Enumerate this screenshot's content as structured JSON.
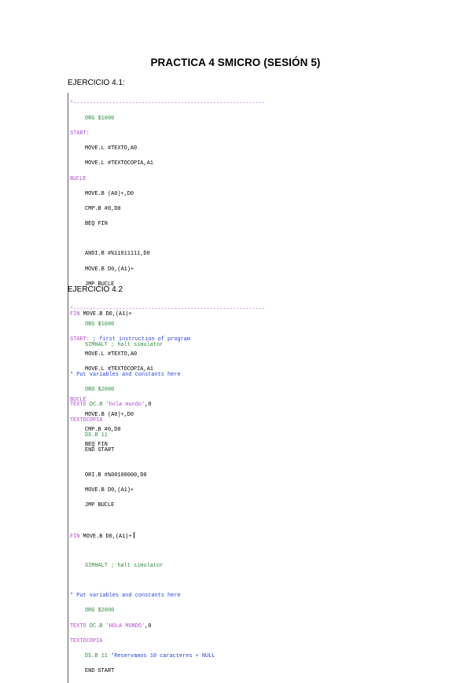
{
  "title": "PRACTICA 4 SMICRO (SESIÓN 5)",
  "ex1": {
    "heading": "EJERCICIO 4.1:",
    "dashes": "*-----------------------------------------------------------",
    "org": "ORG $1000",
    "start": "START:",
    "l1": "MOVE.L #TEXTO,A0",
    "l2": "MOVE.L #TEXTOCOPIA,A1",
    "bucle": "BUCLE",
    "l3": "MOVE.B (A0)+,D0",
    "l4": "CMP.B #0,D0",
    "l5": "BEQ FIN",
    "l6": "ANDI.B #%11011111,D0",
    "l7": "MOVE.B D0,(A1)+",
    "l8": "JMP BUCLE",
    "fin_label": "FIN",
    "fin_instr": "MOVE.B D0,(A1)+",
    "simhalt": "SIMHALT ; halt simulator",
    "comment": "* Put variables and constants here",
    "org2": "ORG $2000",
    "texto_label": "TEXTO",
    "texto_dir": "DC.B",
    "texto_str": "'hola mundo'",
    "texto_end": ",0",
    "textocopia": "TEXTOCOPIA",
    "ds": "DS.B 11",
    "end": "END START"
  },
  "ex2": {
    "heading": "EJERCICIO 4.2",
    "dashes": "*-----------------------------------------------------------",
    "org": "ORG $1000",
    "start": "START:",
    "start_comment": "; first instruction of program",
    "l1": "MOVE.L #TEXTO,A0",
    "l2": "MOVE.L #TEXTOCOPIA,A1",
    "bucle": "BUCLE",
    "l3": "MOVE.B (A0)+,D0",
    "l4": "CMP.B #0,D0",
    "l5": "BEQ FIN",
    "l6": "ORI.B #%00100000,D0",
    "l7": "MOVE.B D0,(A1)+",
    "l8": "JMP BUCLE",
    "fin_label": "FIN",
    "fin_instr": "MOVE.B D0,(A1)+",
    "simhalt": "SIMHALT ; halt simulator",
    "comment": "* Put variables and constants here",
    "org2": "ORG $2000",
    "texto_label": "TEXTO",
    "texto_dir": "DC.B",
    "texto_str": "'HOLA MUNDO'",
    "texto_end": ",0",
    "textocopia": "TEXTOCOPIA",
    "ds": "DS.B 11",
    "ds_comment": "*Reservamos 10 caracteres + NULL",
    "end": "END START"
  }
}
